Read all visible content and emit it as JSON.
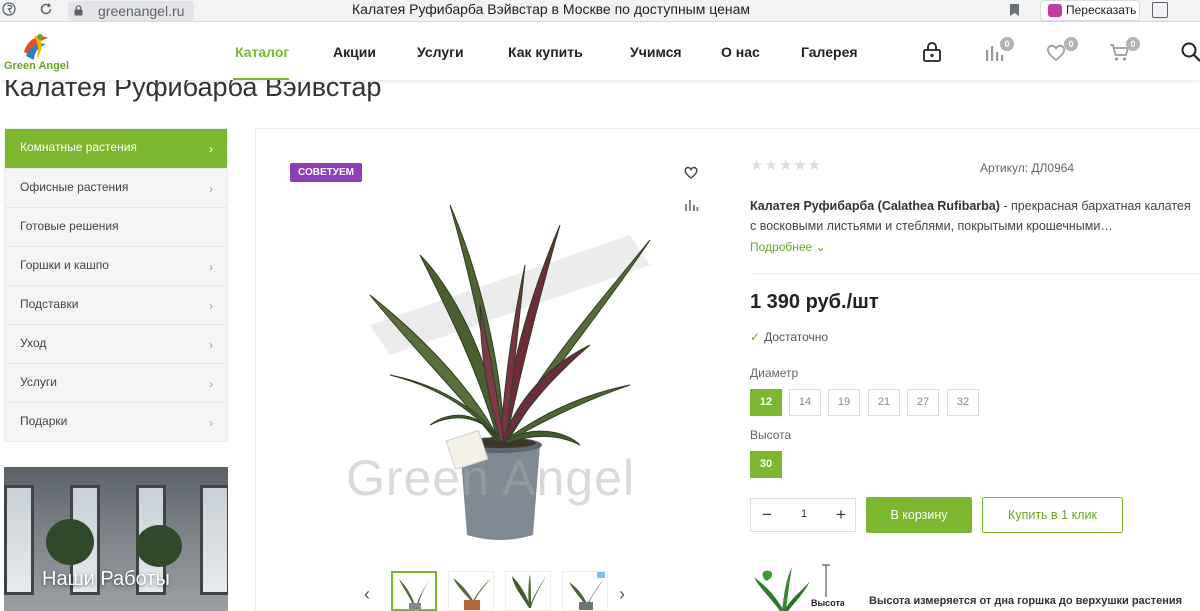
{
  "browser": {
    "url": "greenangel.ru",
    "tab_title": "Калатея Руфибарба Вэйвстар в Москве по доступным ценам",
    "retell_label": "Пересказать",
    "icons": [
      "yandex-icon",
      "reload-icon",
      "lock-icon",
      "bookmark-icon",
      "retell-icon",
      "extension-icon"
    ]
  },
  "header": {
    "logo_text": "Green Angel",
    "nav": [
      {
        "label": "Каталог",
        "active": true
      },
      {
        "label": "Акции"
      },
      {
        "label": "Услуги"
      },
      {
        "label": "Как купить"
      },
      {
        "label": "Учимся"
      },
      {
        "label": "О нас"
      },
      {
        "label": "Галерея"
      }
    ],
    "icons": [
      {
        "name": "account-lock-icon"
      },
      {
        "name": "compare-icon",
        "count": "0"
      },
      {
        "name": "favorites-icon",
        "count": "0"
      },
      {
        "name": "cart-icon",
        "count": "0"
      },
      {
        "name": "search-icon"
      }
    ],
    "accent_color": "#7cb82f"
  },
  "page_title": "Калатея Руфибарба Вэйвстар",
  "sidebar": {
    "items": [
      {
        "label": "Комнатные растения",
        "active": true,
        "chevron": "›"
      },
      {
        "label": "Офисные растения",
        "chevron": "›"
      },
      {
        "label": "Готовые решения",
        "chevron": ""
      },
      {
        "label": "Горшки и кашпо",
        "chevron": "›"
      },
      {
        "label": "Подставки",
        "chevron": "›"
      },
      {
        "label": "Уход",
        "chevron": "›"
      },
      {
        "label": "Услуги",
        "chevron": "›"
      },
      {
        "label": "Подарки",
        "chevron": "›"
      }
    ],
    "works_banner": "Наши Работы"
  },
  "product": {
    "badge": "СОВЕТУЕМ",
    "badge_color": "#8e3fb7",
    "watermark": "Green Angel",
    "rating_stars": "★★★★★",
    "rating": 0,
    "article": "Артикул: ДЛ0964",
    "desc_bold": "Калатея Руфибарба (Calathea Rufibarba)",
    "desc_rest": " - прекрасная бархатная калатея с восковыми листьями и стеблями, покрытыми крошечными…",
    "more_link": "Подробнее",
    "price": "1 390 руб./шт",
    "stock": "Достаточно",
    "diameter_label": "Диаметр",
    "diameters": [
      "12",
      "14",
      "19",
      "21",
      "27",
      "32"
    ],
    "diameter_selected": "12",
    "height_label": "Высота",
    "heights": [
      "30"
    ],
    "height_selected": "30",
    "qty_minus": "−",
    "qty_plus": "+",
    "qty": "1",
    "cart_button": "В корзину",
    "one_click_button": "Купить в 1 клик",
    "height_image_label": "Высота",
    "height_note": "Высота измеряется от дна горшка до верхушки растения",
    "thumbnails": 4,
    "thumb_active": 1
  }
}
